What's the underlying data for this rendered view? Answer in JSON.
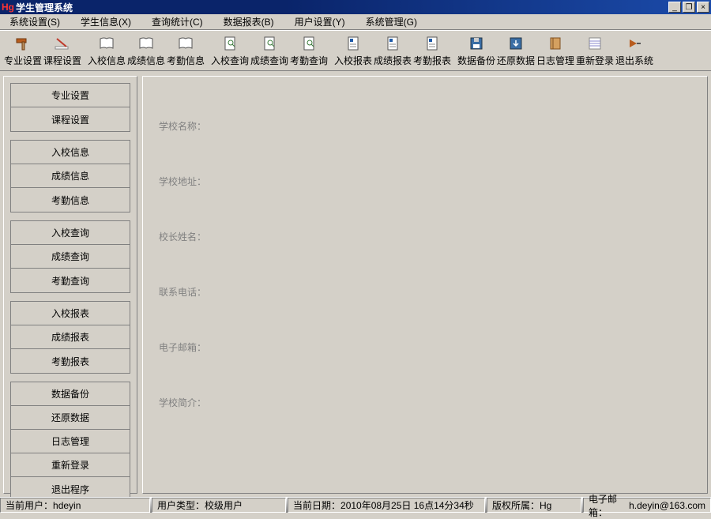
{
  "window": {
    "logo": "Hg",
    "title": "学生管理系统"
  },
  "menus": {
    "sys": "系统设置(S)",
    "stu": "学生信息(X)",
    "query": "查询统计(C)",
    "report": "数据报表(B)",
    "user": "用户设置(Y)",
    "admin": "系统管理(G)"
  },
  "toolbar": {
    "b1": "专业设置",
    "b2": "课程设置",
    "b3": "入校信息",
    "b4": "成绩信息",
    "b5": "考勤信息",
    "b6": "入校查询",
    "b7": "成绩查询",
    "b8": "考勤查询",
    "b9": "入校报表",
    "b10": "成绩报表",
    "b11": "考勤报表",
    "b12": "数据备份",
    "b13": "还原数据",
    "b14": "日志管理",
    "b15": "重新登录",
    "b16": "退出系统"
  },
  "sidebar": {
    "g1": [
      "专业设置",
      "课程设置"
    ],
    "g2": [
      "入校信息",
      "成绩信息",
      "考勤信息"
    ],
    "g3": [
      "入校查询",
      "成绩查询",
      "考勤查询"
    ],
    "g4": [
      "入校报表",
      "成绩报表",
      "考勤报表"
    ],
    "g5": [
      "数据备份",
      "还原数据",
      "日志管理",
      "重新登录",
      "退出程序"
    ]
  },
  "form": {
    "school_name": "学校名称：",
    "school_addr": "学校地址：",
    "principal": "校长姓名：",
    "phone": "联系电话：",
    "email": "电子邮箱：",
    "intro": "学校简介："
  },
  "status": {
    "user_label": "当前用户：",
    "user_value": "hdeyin",
    "type_label": "用户类型：",
    "type_value": "校级用户",
    "date_label": "当前日期：",
    "date_value": "2010年08月25日 16点14分34秒",
    "copy_label": "版权所属：",
    "copy_value": "Hg",
    "mail_label": "电子邮箱：",
    "mail_value": "h.deyin@163.com"
  }
}
